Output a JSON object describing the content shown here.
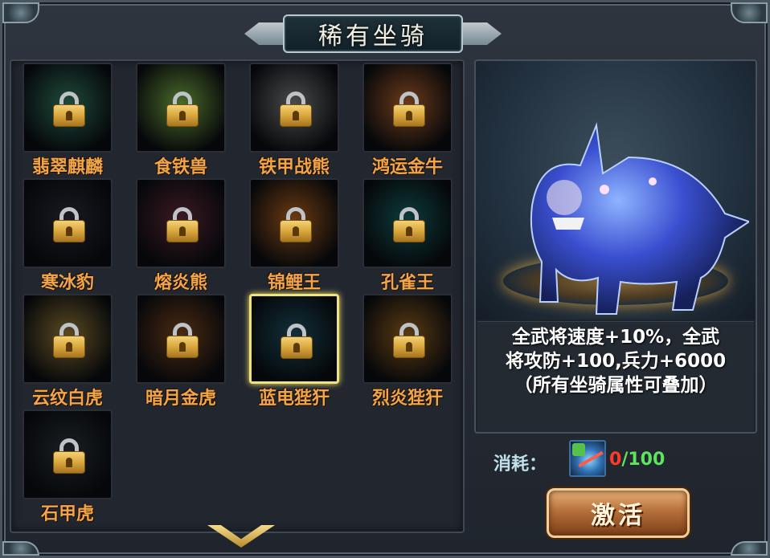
{
  "window": {
    "title": "稀有坐骑"
  },
  "mounts": [
    {
      "name": "翡翠麒麟",
      "locked": true,
      "selected": false,
      "tint": "#1f4a3a"
    },
    {
      "name": "食铁兽",
      "locked": true,
      "selected": false,
      "tint": "#4a6a2a"
    },
    {
      "name": "铁甲战熊",
      "locked": true,
      "selected": false,
      "tint": "#4a4a4a"
    },
    {
      "name": "鸿运金牛",
      "locked": true,
      "selected": false,
      "tint": "#6a3a1a"
    },
    {
      "name": "寒冰豹",
      "locked": true,
      "selected": false,
      "tint": "#1a1a22"
    },
    {
      "name": "熔炎熊",
      "locked": true,
      "selected": false,
      "tint": "#3a1a22"
    },
    {
      "name": "锦鲤王",
      "locked": true,
      "selected": false,
      "tint": "#6a3a12"
    },
    {
      "name": "孔雀王",
      "locked": true,
      "selected": false,
      "tint": "#0e3a3a"
    },
    {
      "name": "云纹白虎",
      "locked": true,
      "selected": false,
      "tint": "#5a4a22"
    },
    {
      "name": "暗月金虎",
      "locked": true,
      "selected": false,
      "tint": "#4a2a12"
    },
    {
      "name": "蓝电狴犴",
      "locked": true,
      "selected": true,
      "tint": "#12303a"
    },
    {
      "name": "烈炎狴犴",
      "locked": true,
      "selected": false,
      "tint": "#5a3a12"
    },
    {
      "name": "石甲虎",
      "locked": true,
      "selected": false,
      "tint": "#1a1e22"
    }
  ],
  "detail": {
    "mount_name": "蓝电狴犴",
    "desc_lines": [
      "全武将速度+10%，全武",
      "将攻防+100,兵力+6000",
      "（所有坐骑属性可叠加）"
    ]
  },
  "cost": {
    "label": "消耗：",
    "have": "0",
    "sep_need": "/100",
    "item_icon": "lightning-shard-icon"
  },
  "actions": {
    "activate_label": "激活"
  },
  "colors": {
    "label_orange": "#f2a548",
    "select_gold": "#f0e37a",
    "cost_red": "#ff3a2a",
    "cost_green": "#5ee35e"
  }
}
